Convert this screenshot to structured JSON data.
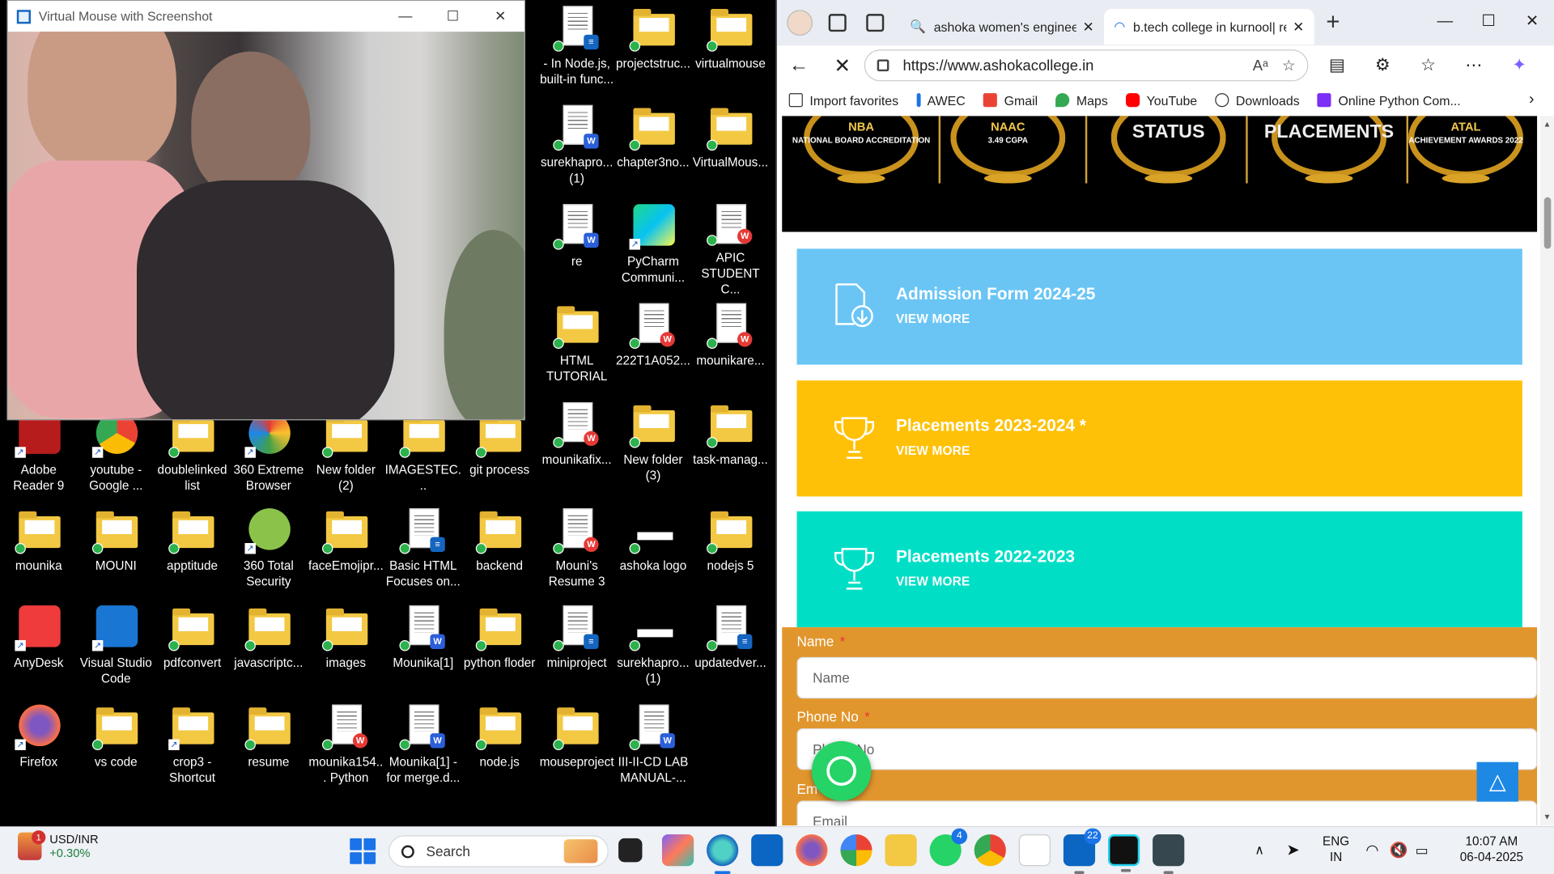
{
  "camera_window": {
    "title": "Virtual Mouse with Screenshot",
    "controls": [
      "—",
      "☐",
      "✕"
    ]
  },
  "desktop": {
    "column1": [
      {
        "label": "Adobe Reader 9",
        "icon": "adobe-reader-icon"
      },
      {
        "label": "mounika",
        "icon": "folder-icon"
      },
      {
        "label": "AnyDesk",
        "icon": "anydesk-icon"
      },
      {
        "label": "Firefox",
        "icon": "firefox-icon"
      }
    ],
    "column2": [
      {
        "label": "youtube - Google ...",
        "icon": "chrome-shortcut-icon"
      },
      {
        "label": "MOUNI",
        "icon": "folder-icon"
      },
      {
        "label": "Visual Studio Code",
        "icon": "vscode-icon"
      },
      {
        "label": "vs code",
        "icon": "folder-icon"
      }
    ],
    "column3": [
      {
        "label": "doublelinked list",
        "icon": "folder-icon"
      },
      {
        "label": "apptitude",
        "icon": "folder-icon"
      },
      {
        "label": "pdfconvert",
        "icon": "folder-icon"
      },
      {
        "label": "crop3 - Shortcut",
        "icon": "folder-shortcut-icon"
      }
    ],
    "column4": [
      {
        "label": "360 Extreme Browser",
        "icon": "360-browser-icon"
      },
      {
        "label": "360 Total Security",
        "icon": "360-security-icon"
      },
      {
        "label": "javascriptc...",
        "icon": "folder-icon"
      },
      {
        "label": "resume",
        "icon": "folder-icon"
      }
    ],
    "column5": [
      {
        "label": "New folder (2)",
        "icon": "folder-icon"
      },
      {
        "label": "faceEmojipr...",
        "icon": "folder-icon"
      },
      {
        "label": "images",
        "icon": "folder-icon"
      },
      {
        "label": "mounika154... Python",
        "icon": "pdf-icon"
      }
    ],
    "column6": [
      {
        "label": "IMAGESTEC...",
        "icon": "folder-icon"
      },
      {
        "label": "Basic HTML Focuses on...",
        "icon": "document-icon"
      },
      {
        "label": "Mounika[1]",
        "icon": "word-icon"
      },
      {
        "label": "Mounika[1] - for merge.d...",
        "icon": "word-icon"
      }
    ],
    "column7": [
      {
        "label": "git process",
        "icon": "folder-icon"
      },
      {
        "label": "backend",
        "icon": "folder-icon"
      },
      {
        "label": "python floder",
        "icon": "folder-icon"
      },
      {
        "label": "node.js",
        "icon": "folder-icon"
      }
    ],
    "column8": [
      {
        "label": "- In Node.js, built-in func...",
        "icon": "document-icon"
      },
      {
        "label": "surekhapro... (1)",
        "icon": "word-icon"
      },
      {
        "label": "re",
        "icon": "word-icon"
      },
      {
        "label": "HTML TUTORIAL",
        "icon": "folder-icon"
      },
      {
        "label": "mounikafix...",
        "icon": "pdf-icon"
      },
      {
        "label": "Mouni's Resume 3",
        "icon": "pdf-icon"
      },
      {
        "label": "miniproject",
        "icon": "document-icon"
      },
      {
        "label": "mouseproject",
        "icon": "folder-icon"
      }
    ],
    "column9": [
      {
        "label": "projectstruc...",
        "icon": "folder-icon"
      },
      {
        "label": "chapter3no...",
        "icon": "folder-icon"
      },
      {
        "label": "PyCharm Communi...",
        "icon": "pycharm-icon"
      },
      {
        "label": "222T1A052...",
        "icon": "pdf-icon"
      },
      {
        "label": "New folder (3)",
        "icon": "folder-icon"
      },
      {
        "label": "ashoka logo",
        "icon": "image-icon"
      },
      {
        "label": "surekhapro... (1)",
        "icon": "image-icon"
      },
      {
        "label": "III-II-CD LAB MANUAL-...",
        "icon": "word-icon"
      }
    ],
    "column10": [
      {
        "label": "virtualmouse",
        "icon": "folder-icon"
      },
      {
        "label": "VirtualMous...",
        "icon": "folder-icon"
      },
      {
        "label": "APIC STUDENT C...",
        "icon": "pdf-icon"
      },
      {
        "label": "mounikare...",
        "icon": "pdf-icon"
      },
      {
        "label": "task-manag...",
        "icon": "folder-icon"
      },
      {
        "label": "nodejs 5",
        "icon": "folder-icon"
      },
      {
        "label": "updatedver...",
        "icon": "document-icon"
      }
    ]
  },
  "browser": {
    "tabs": [
      {
        "title": "ashoka women's engineering",
        "icon": "search-icon"
      },
      {
        "title": "b.tech college in kurnool| re",
        "icon": "loading-icon"
      }
    ],
    "url": "https://www.ashokacollege.in",
    "favorites": [
      "Import favorites",
      "AWEC",
      "Gmail",
      "Maps",
      "YouTube",
      "Downloads",
      "Online Python Com..."
    ],
    "awards": [
      {
        "line1": "NBA",
        "line2": "NATIONAL BOARD ACCREDITATION"
      },
      {
        "line1": "NAAC",
        "line2": "3.49 CGPA"
      },
      {
        "line1": "STATUS",
        "line2": ""
      },
      {
        "line1": "PLACEMENTS",
        "line2": ""
      },
      {
        "line1": "ATAL",
        "line2": "ACHIEVEMENT AWARDS 2022"
      }
    ],
    "cards": [
      {
        "title": "Admission Form 2024-25",
        "more": "VIEW MORE",
        "color": "#6ac5f5",
        "icon": "document-download-icon"
      },
      {
        "title": "Placements 2023-2024 *",
        "more": "VIEW MORE",
        "color": "#ffc107",
        "icon": "trophy-icon"
      },
      {
        "title": "Placements 2022-2023",
        "more": "VIEW MORE",
        "color": "#00dfc6",
        "icon": "trophy-icon"
      }
    ],
    "form": {
      "name_label": "Name",
      "name_placeholder": "Name",
      "phone_label": "Phone No",
      "phone_placeholder": "Phone No",
      "email_label": "Em",
      "email_placeholder": "Email",
      "required_mark": "*"
    }
  },
  "taskbar": {
    "ticker": {
      "pair": "USD/INR",
      "change": "+0.30%",
      "notifications": "1"
    },
    "search_placeholder": "Search",
    "whatsapp_badge": "4",
    "linkedin_badge": "22",
    "language": [
      "ENG",
      "IN"
    ],
    "time": "10:07 AM",
    "date": "06-04-2025"
  }
}
